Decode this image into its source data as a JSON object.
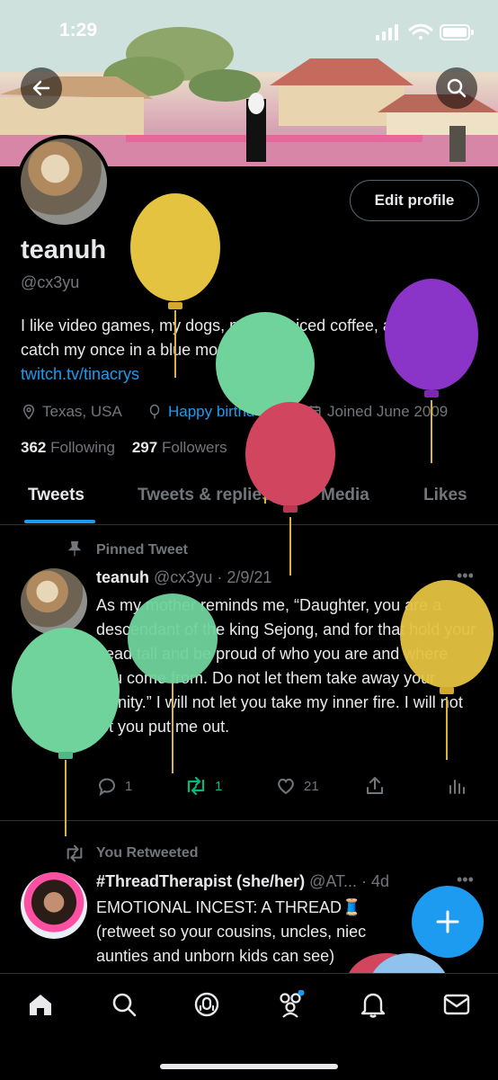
{
  "status_bar": {
    "time": "1:29"
  },
  "profile": {
    "display_name": "teanuh",
    "handle": "@cx3yu",
    "edit_label": "Edit profile",
    "bio_text": "I like video games, my dogs, makeup, iced coffee, and movies. catch my once in a blue moon streams",
    "bio_link": "twitch.tv/tinacrys",
    "location": "Texas, USA",
    "birthday": "Happy birthd",
    "joined": "Joined June 2009",
    "following_count": "362",
    "following_label": "Following",
    "followers_count": "297",
    "followers_label": "Followers"
  },
  "tabs": [
    {
      "label": "Tweets"
    },
    {
      "label": "Tweets & replies"
    },
    {
      "label": "Media"
    },
    {
      "label": "Likes"
    }
  ],
  "tweets": [
    {
      "context": "Pinned Tweet",
      "name": "teanuh",
      "handle_time": "@cx3yu · 2/9/21",
      "text": "As my mother reminds me, “Daughter, you are a descendant of the king Sejong, and for that hold  your head tall and be proud of who you are and where you come from. Do not let them take away your dignity.” I will not let you take my inner fire. I will not let you put me out.",
      "replies": "1",
      "retweets": "1",
      "likes": "21"
    },
    {
      "context": "You Retweeted",
      "name": "#ThreadTherapist (she/her)",
      "handle_time": "@AT... · 4d",
      "text_line1": "EMOTIONAL INCEST: A THREAD🧵",
      "text_line2": "(retweet so your cousins, uncles, niec",
      "text_line3": "aunties and unborn kids can see)"
    }
  ],
  "icons": [
    "back-arrow-icon",
    "search-icon",
    "location-icon",
    "balloon-icon",
    "calendar-icon",
    "pin-icon",
    "reply-icon",
    "retweet-icon",
    "like-icon",
    "share-icon",
    "analytics-icon",
    "more-icon",
    "plus-icon",
    "home-icon",
    "spaces-icon",
    "communities-icon",
    "bell-icon",
    "mail-icon"
  ],
  "colors": {
    "accent": "#1d9bf0",
    "retweet": "#00ba7c",
    "background": "#000000"
  }
}
